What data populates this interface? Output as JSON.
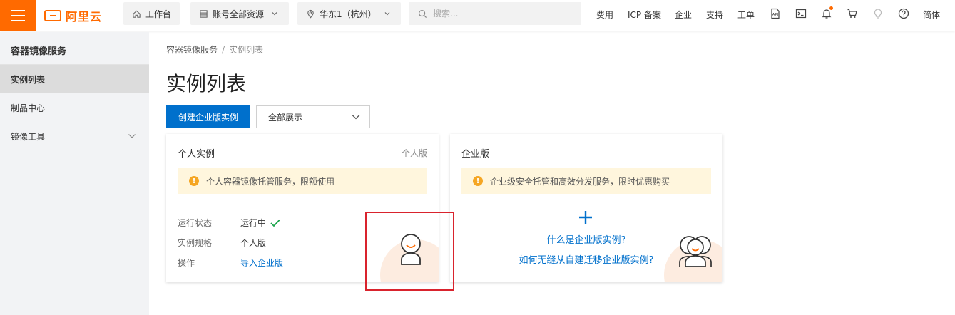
{
  "topbar": {
    "logo_text": "阿里云",
    "workbench": "工作台",
    "resources": "账号全部资源",
    "region": "华东1（杭州）",
    "search_placeholder": "搜索...",
    "links": [
      "费用",
      "ICP 备案",
      "企业",
      "支持",
      "工单"
    ],
    "lang": "简体",
    "brand_color": "#ff6a00"
  },
  "sidebar": {
    "title": "容器镜像服务",
    "items": [
      {
        "label": "实例列表",
        "active": true
      },
      {
        "label": "制品中心"
      },
      {
        "label": "镜像工具",
        "expandable": true
      }
    ]
  },
  "main": {
    "breadcrumb": [
      "容器镜像服务",
      "/",
      "实例列表"
    ],
    "title": "实例列表",
    "create_button": "创建企业版实例",
    "filter_select": "全部展示",
    "accent_color": "#0070cc"
  },
  "personal_card": {
    "title": "个人实例",
    "tag": "个人版",
    "notice": "个人容器镜像托管服务，限额使用",
    "rows": [
      {
        "key": "运行状态",
        "value": "运行中"
      },
      {
        "key": "实例规格",
        "value": "个人版"
      },
      {
        "key": "操作",
        "value": "导入企业版"
      }
    ]
  },
  "enterprise_card": {
    "title": "企业版",
    "notice": "企业级安全托管和高效分发服务，限时优惠购买",
    "link1": "什么是企业版实例?",
    "link2": "如何无缝从自建迁移企业版实例?"
  }
}
